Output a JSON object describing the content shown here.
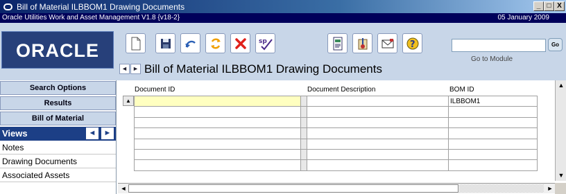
{
  "window": {
    "title": "Bill of Material ILBBOM1 Drawing Documents",
    "min_label": "_",
    "max_label": "□",
    "close_label": "X"
  },
  "subbar": {
    "app_name": "Oracle Utilities Work and Asset Management V1.8 {v18-2}",
    "date": "05 January  2009"
  },
  "header": {
    "logo_text": "ORACLE",
    "toolbar_icons": [
      "new-document-icon",
      "save-icon",
      "undo-icon",
      "refresh-icon",
      "delete-icon",
      "spell-check-icon",
      "report-icon",
      "attachment-icon",
      "email-icon",
      "help-icon"
    ],
    "goto_label": "Go to Module",
    "goto_value": "",
    "go_button": "Go",
    "page_title": "Bill of Material ILBBOM1 Drawing Documents",
    "nav_prev": "◄",
    "nav_next": "►"
  },
  "sidebar": {
    "buttons": [
      "Search Options",
      "Results",
      "Bill of Material"
    ],
    "views_label": "Views",
    "views_prev": "◄",
    "views_next": "►",
    "items": [
      "Notes",
      "Drawing Documents",
      "Associated Assets"
    ]
  },
  "grid": {
    "headers": [
      "Document ID",
      "Document Description",
      "BOM ID"
    ],
    "rows": [
      [
        "",
        "",
        "ILBBOM1"
      ],
      [
        "",
        "",
        ""
      ],
      [
        "",
        "",
        ""
      ],
      [
        "",
        "",
        ""
      ],
      [
        "",
        "",
        ""
      ],
      [
        "",
        "",
        ""
      ],
      [
        "",
        "",
        ""
      ]
    ]
  },
  "colors": {
    "title_bar": "#0a246a",
    "sub_bar": "#00005a",
    "header_band": "#c8d6e8",
    "logo_bg": "#27407a",
    "views_bar": "#1c3f86",
    "selected_cell": "#ffffc0"
  }
}
